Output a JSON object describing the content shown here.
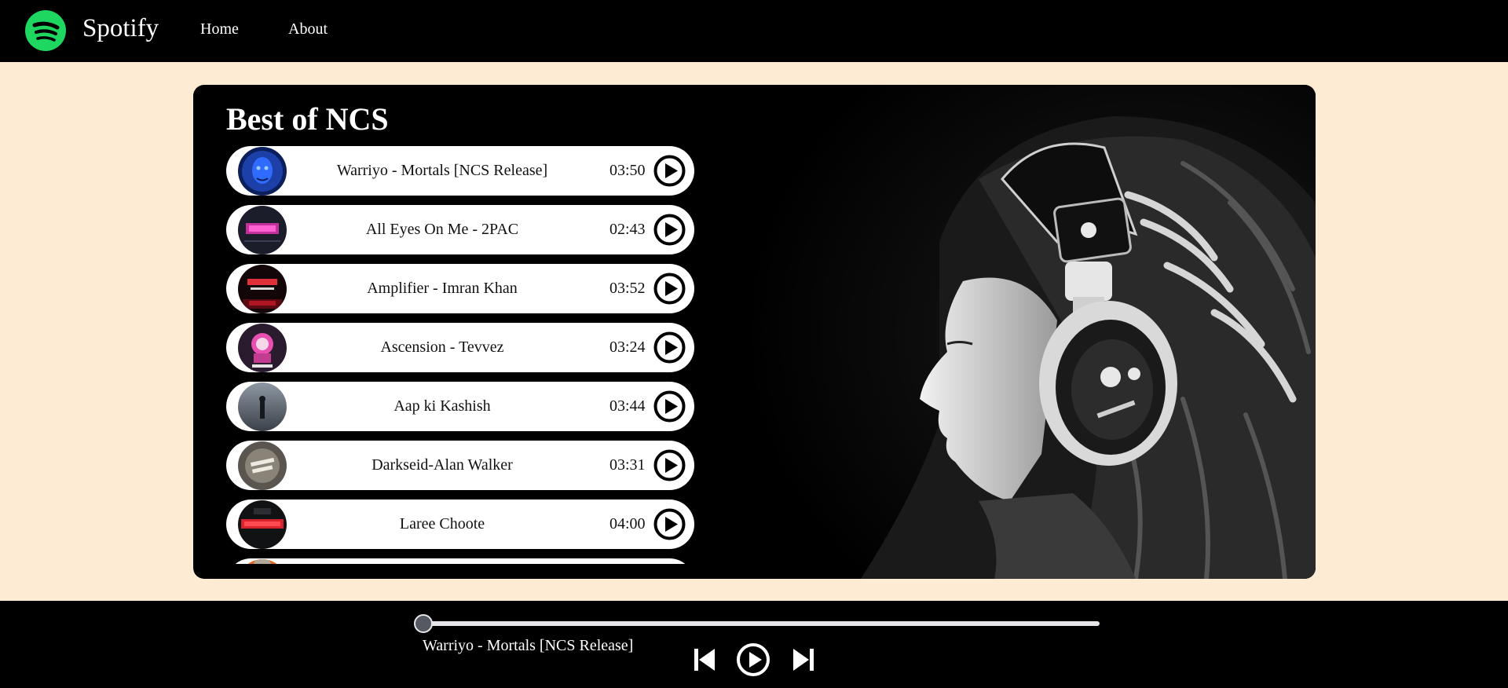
{
  "nav": {
    "brand": "Spotify",
    "links": [
      "Home",
      "About"
    ]
  },
  "playlist": {
    "title": "Best of NCS",
    "songs": [
      {
        "name": "Warriyo - Mortals [NCS Release]",
        "duration": "03:50",
        "cover": "blue-mask-cover"
      },
      {
        "name": "All Eyes On Me - 2PAC",
        "duration": "02:43",
        "cover": "neon-title-cover"
      },
      {
        "name": "Amplifier - Imran Khan",
        "duration": "03:52",
        "cover": "red-text-cover"
      },
      {
        "name": "Ascension - Tevvez",
        "duration": "03:24",
        "cover": "astronaut-cover"
      },
      {
        "name": "Aap ki Kashish",
        "duration": "03:44",
        "cover": "foggy-figure-cover"
      },
      {
        "name": "Darkseid-Alan Walker",
        "duration": "03:31",
        "cover": "safety-dance-cover"
      },
      {
        "name": "Laree Choote",
        "duration": "04:00",
        "cover": "back-it-up-cover"
      },
      {
        "name": "",
        "duration": "",
        "cover": "orange-cover"
      }
    ]
  },
  "player": {
    "now_playing": "Warriyo - Mortals [NCS Release]",
    "progress": 0
  },
  "colors": {
    "brand_green": "#1ed760",
    "page_bg": "#fdebd4",
    "bar_bg": "#000000"
  }
}
